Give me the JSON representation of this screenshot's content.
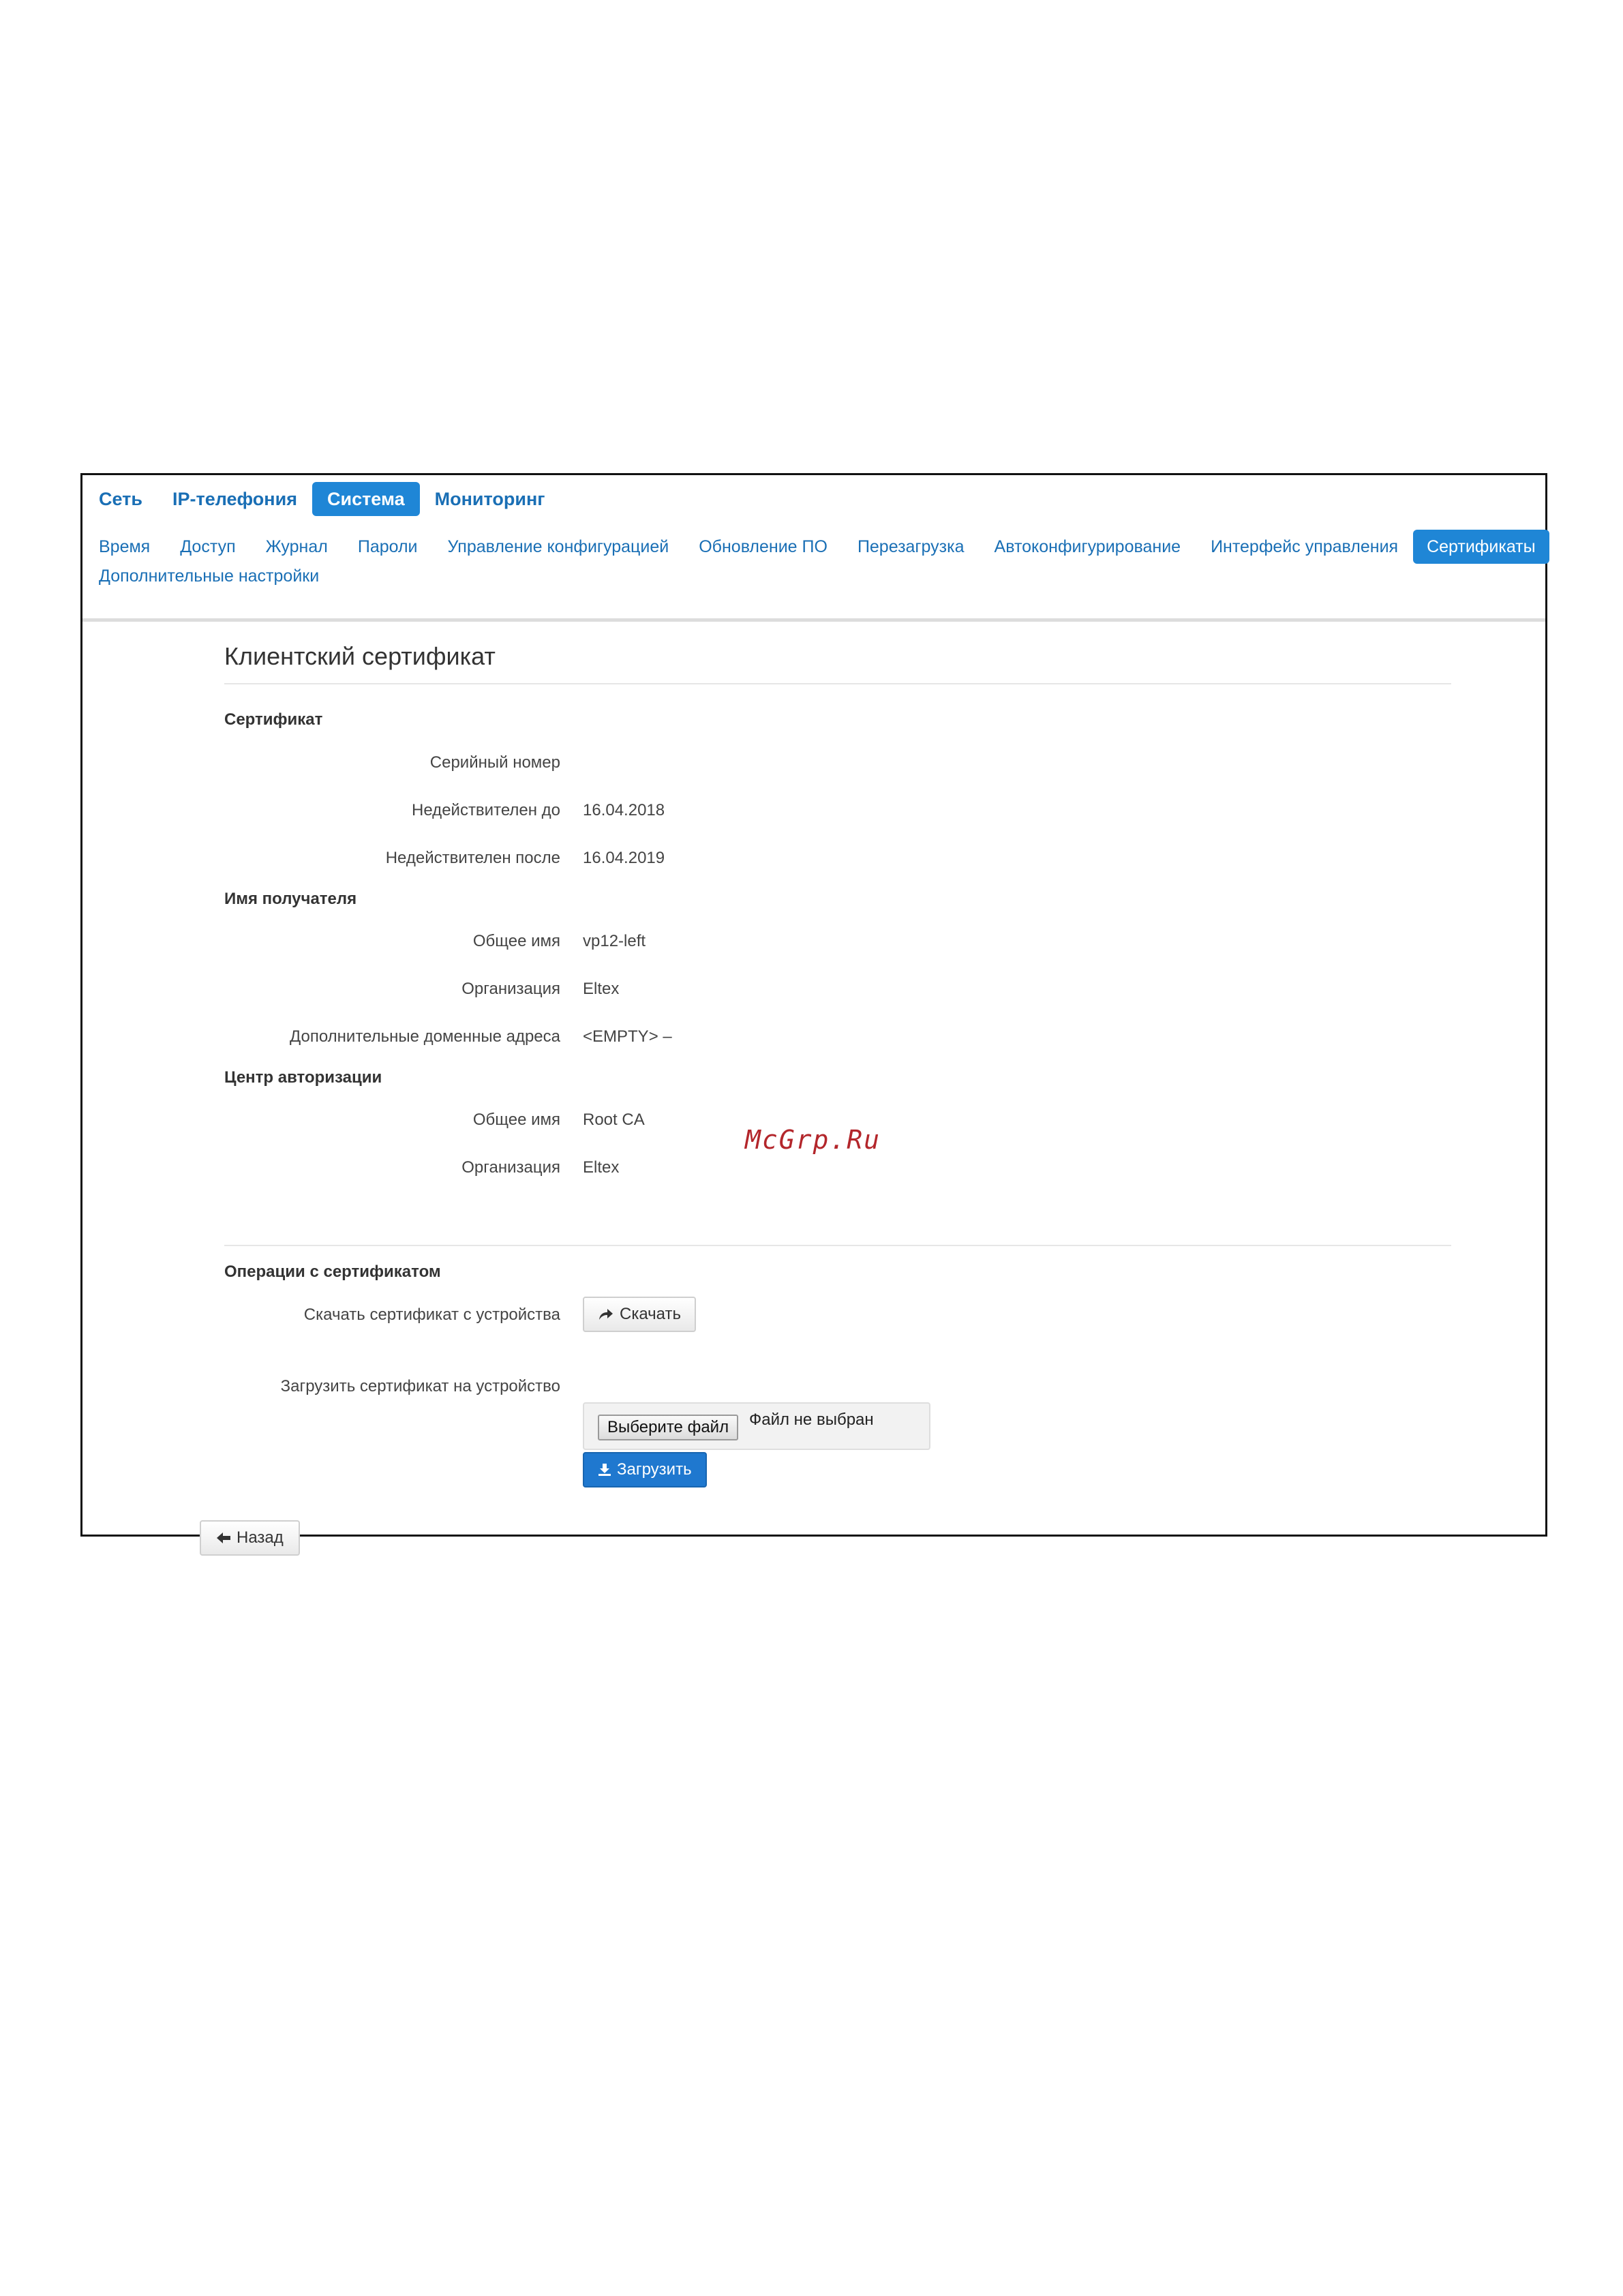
{
  "top_nav": [
    {
      "label": "Сеть",
      "active": false
    },
    {
      "label": "IP-телефония",
      "active": false
    },
    {
      "label": "Система",
      "active": true
    },
    {
      "label": "Мониторинг",
      "active": false
    }
  ],
  "sub_nav": [
    "Время",
    "Доступ",
    "Журнал",
    "Пароли",
    "Управление конфигурацией",
    "Обновление ПО",
    "Перезагрузка",
    "Автоконфигурирование",
    "Интерфейс управления",
    "Сертификаты",
    "Дополнительные настройки"
  ],
  "sub_nav_active": "Сертификаты",
  "page": {
    "title": "Клиентский сертификат",
    "certificate": {
      "heading": "Сертификат",
      "serial_label": "Серийный номер",
      "serial_value": "",
      "not_before_label": "Недействителен до",
      "not_before_value": "16.04.2018",
      "not_after_label": "Недействителен после",
      "not_after_value": "16.04.2019"
    },
    "subject": {
      "heading": "Имя получателя",
      "cn_label": "Общее имя",
      "cn_value": "vp12-left",
      "org_label": "Организация",
      "org_value": "Eltex",
      "san_label": "Дополнительные доменные адреса",
      "san_value": "<EMPTY> –"
    },
    "issuer": {
      "heading": "Центр авторизации",
      "cn_label": "Общее имя",
      "cn_value": "Root CA",
      "org_label": "Организация",
      "org_value": "Eltex"
    },
    "operations": {
      "heading": "Операции с сертификатом",
      "download_label": "Скачать сертификат с устройства",
      "download_button": "Скачать",
      "upload_label": "Загрузить сертификат на устройство",
      "choose_file_button": "Выберите файл",
      "file_status": "Файл не выбран",
      "upload_button": "Загрузить"
    },
    "back_button": "Назад"
  },
  "watermark": "McGrp.Ru",
  "colors": {
    "accent": "#1f86d6",
    "link": "#1a6fb5",
    "watermark": "#b3262b"
  }
}
